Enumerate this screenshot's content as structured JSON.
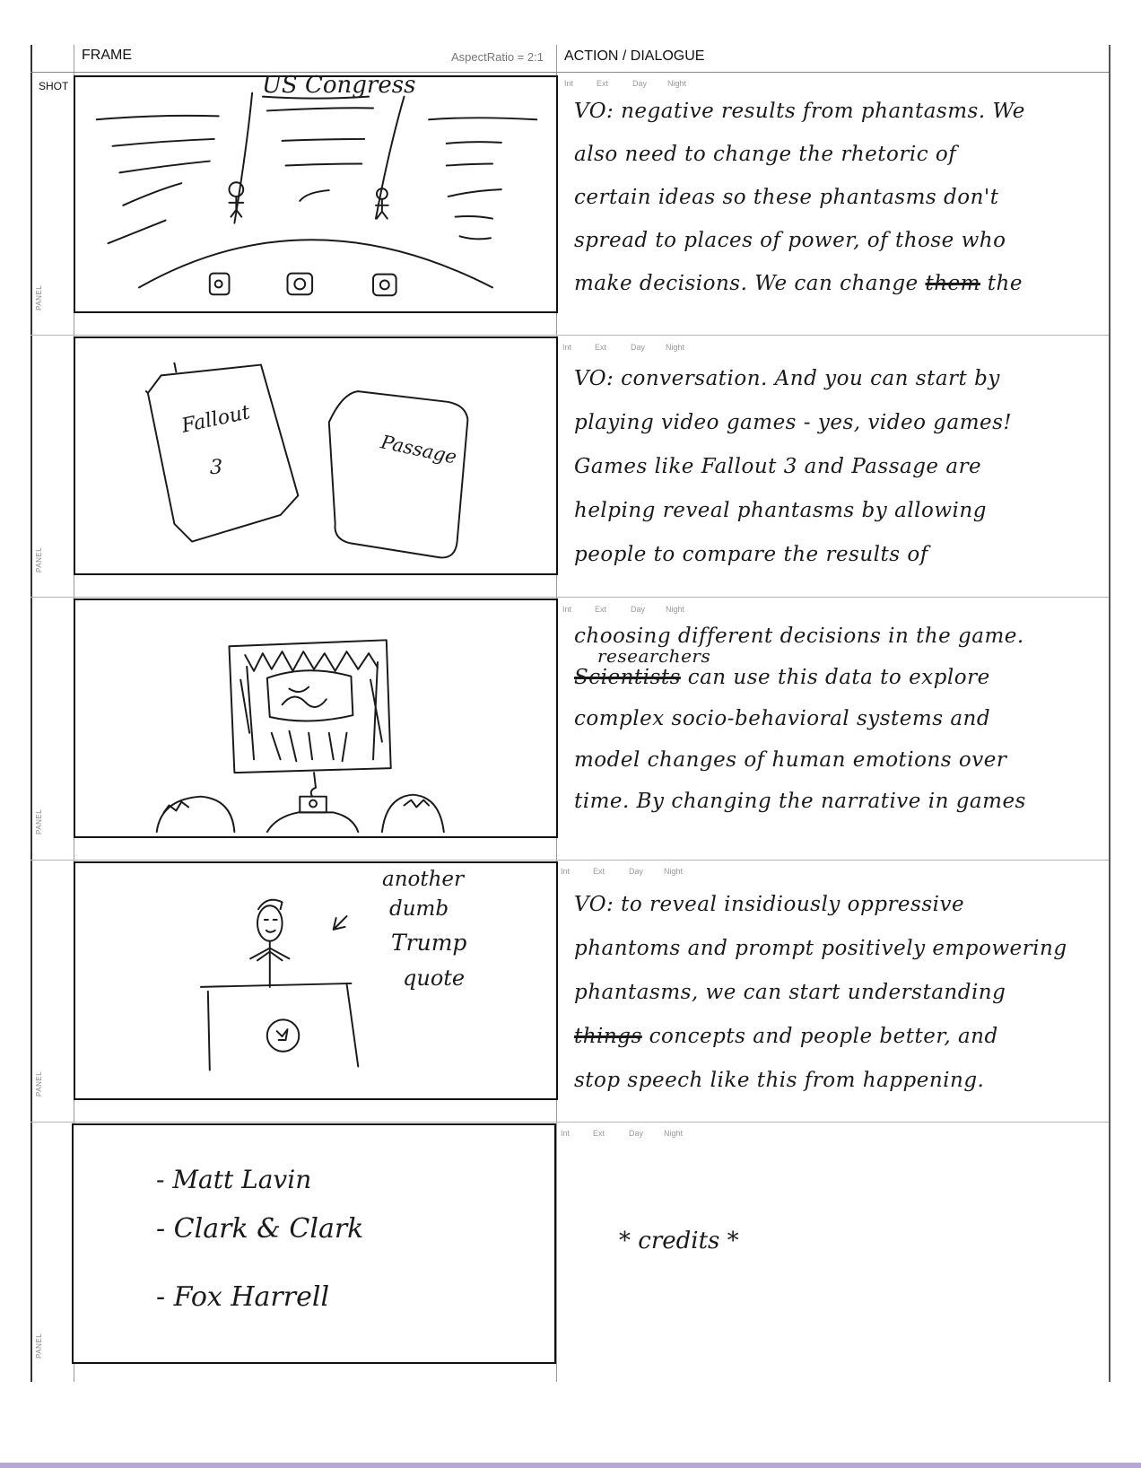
{
  "header": {
    "frame_label": "FRAME",
    "aspect_ratio": "AspectRatio = 2:1",
    "action_dialogue": "ACTION / DIALOGUE",
    "shot_label": "SHOT",
    "panel_label": "PANEL",
    "int": "Int",
    "ext": "Ext",
    "day": "Day",
    "night": "Night"
  },
  "panels": [
    {
      "sketch": {
        "caption": "US Congress"
      },
      "dialogue": [
        "VO: negative results from phantasms. We",
        "also need to change the rhetoric of",
        "certain ideas so these phantasms don't",
        "spread to places of power, of those who",
        "make decisions. We can change"
      ],
      "dialogue_strike": "them",
      "dialogue_tail": "the"
    },
    {
      "sketch": {
        "card_left_line1": "Fallout",
        "card_left_line2": "3",
        "card_right": "Passage"
      },
      "dialogue": [
        "VO: conversation. And you can start by",
        "playing video games - yes, video games!",
        "Games like Fallout 3 and Passage are",
        "helping reveal phantasms by allowing",
        "people to compare the results of"
      ]
    },
    {
      "sketch": {},
      "dialogue_line1": "choosing different decisions in the game.",
      "dialogue_insert": "researchers",
      "dialogue_strike": "Scientists",
      "dialogue_line2": "can use this data to explore",
      "dialogue": [
        "complex socio-behavioral systems and",
        "model changes of human emotions over",
        "time. By changing the narrative in games"
      ]
    },
    {
      "sketch": {
        "note_line1": "another",
        "note_line2": "dumb",
        "note_line3": "Trump",
        "note_line4": "quote"
      },
      "dialogue": [
        "VO: to reveal insidiously oppressive",
        "phantoms and prompt positively empowering",
        "phantasms, we can start understanding"
      ],
      "dialogue_strike": "things",
      "dialogue_line4": "concepts and people better, and",
      "dialogue_line5": "stop speech like this from happening."
    },
    {
      "sketch": {
        "credits": [
          "- Matt Lavin",
          "- Clark & Clark",
          "- Fox Harrell"
        ]
      },
      "dialogue_center": "* credits *"
    }
  ]
}
